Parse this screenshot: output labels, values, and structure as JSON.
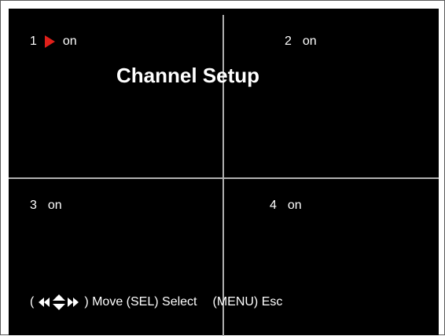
{
  "title": "Channel Setup",
  "channels": [
    {
      "number": "1",
      "state": "on",
      "selected": true
    },
    {
      "number": "2",
      "state": "on",
      "selected": false
    },
    {
      "number": "3",
      "state": "on",
      "selected": false
    },
    {
      "number": "4",
      "state": "on",
      "selected": false
    }
  ],
  "help": {
    "open_paren": "(",
    "nav_icon": "direction-arrows-icon",
    "move_text": ") Move (SEL) Select",
    "esc_text": "(MENU) Esc"
  },
  "colors": {
    "background": "#000000",
    "text": "#ffffff",
    "cursor": "#e0201a",
    "grid_line": "#b0b0b0"
  }
}
